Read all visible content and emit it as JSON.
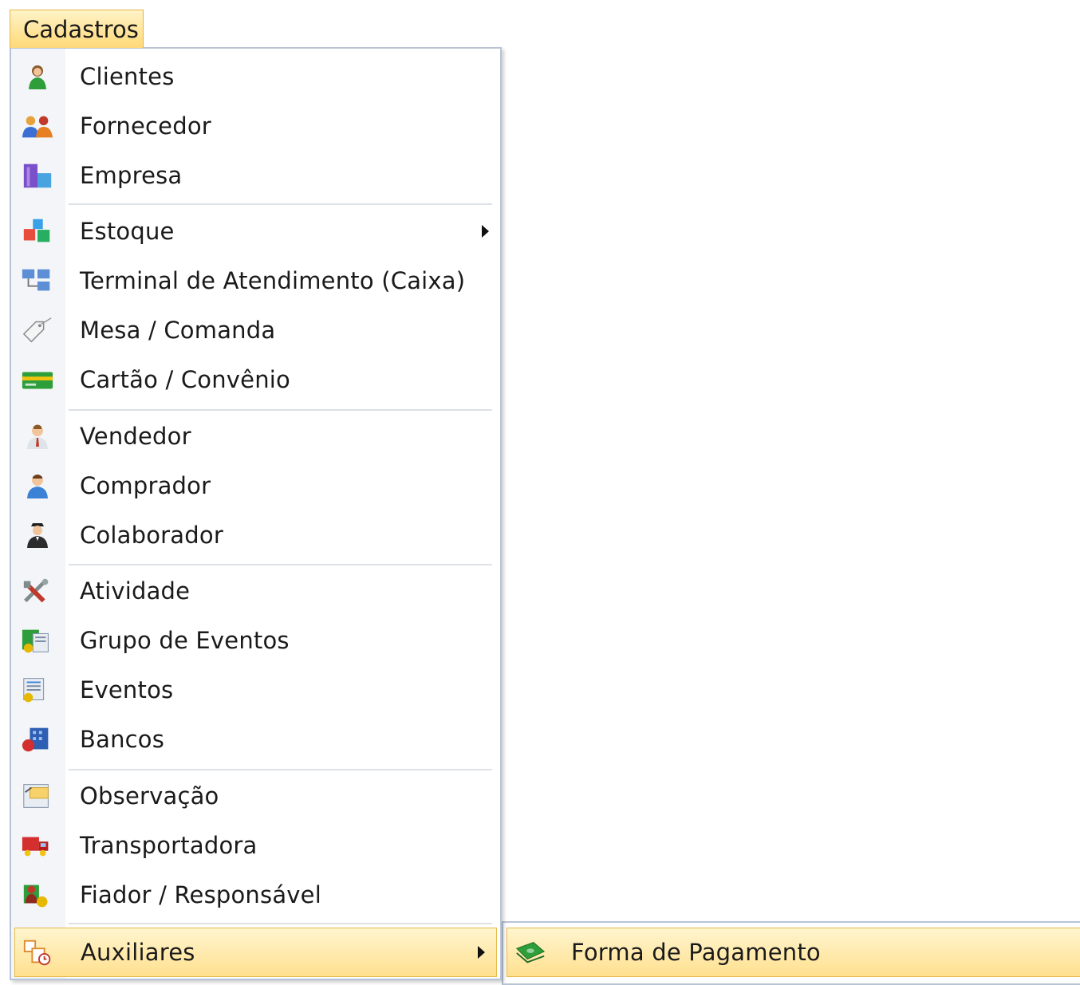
{
  "menubar": {
    "label": "Cadastros"
  },
  "menu": {
    "items": [
      {
        "label": "Clientes",
        "icon": "user-green-icon"
      },
      {
        "label": "Fornecedor",
        "icon": "users-pair-icon"
      },
      {
        "label": "Empresa",
        "icon": "building-icon"
      },
      {
        "label": "Estoque",
        "icon": "boxes-icon",
        "submenu": true
      },
      {
        "label": "Terminal de Atendimento (Caixa)",
        "icon": "network-terminals-icon"
      },
      {
        "label": "Mesa / Comanda",
        "icon": "tag-icon"
      },
      {
        "label": "Cartão / Convênio",
        "icon": "card-icon"
      },
      {
        "label": "Vendedor",
        "icon": "salesperson-icon"
      },
      {
        "label": "Comprador",
        "icon": "buyer-icon"
      },
      {
        "label": "Colaborador",
        "icon": "collaborator-icon"
      },
      {
        "label": "Atividade",
        "icon": "tools-icon"
      },
      {
        "label": "Grupo de Eventos",
        "icon": "event-group-icon"
      },
      {
        "label": "Eventos",
        "icon": "events-icon"
      },
      {
        "label": "Bancos",
        "icon": "bank-icon"
      },
      {
        "label": "Observação",
        "icon": "note-icon"
      },
      {
        "label": "Transportadora",
        "icon": "truck-icon"
      },
      {
        "label": "Fiador / Responsável",
        "icon": "guarantor-icon"
      },
      {
        "label": "Auxiliares",
        "icon": "auxiliary-icon",
        "submenu": true,
        "highlighted": true
      }
    ]
  },
  "submenu": {
    "items": [
      {
        "label": "Forma de Pagamento",
        "icon": "money-icon",
        "highlighted": true
      }
    ]
  },
  "colors": {
    "highlight": "#ffe08f",
    "highlight_border": "#e6b94a",
    "menu_border": "#b8c4d4"
  }
}
